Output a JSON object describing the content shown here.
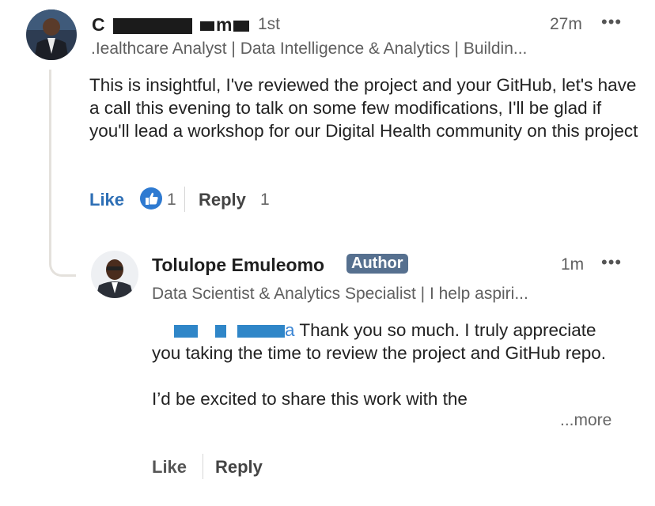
{
  "comment": {
    "author_name_visible": "C",
    "author_name_mid": "m",
    "degree": "1st",
    "time": "27m",
    "menu_icon": "more-dots-icon",
    "headline": ".Iealthcare Analyst | Data Intelligence & Analytics | Buildin...",
    "body": "This is insightful,  I've reviewed the project and your GitHub, let's have a call this evening to talk on some few modifications,  I'll be glad if you'll lead a workshop for our Digital Health community on this project",
    "like_label": "Like",
    "reaction_icon": "thumbs-up-icon",
    "reaction_count": "1",
    "reply_label": "Reply",
    "reply_count": "1"
  },
  "reply": {
    "author_name": "Tolulope Emuleomo",
    "badge": "Author",
    "time": "1m",
    "menu_icon": "more-dots-icon",
    "headline": "Data Scientist & Analytics Specialist | I help aspiri...",
    "mention_tail": "a",
    "body_line1": " Thank you so much. I truly appreciate you taking the time to review the project and GitHub repo.",
    "body_line2": "I’d be excited to share this work with the",
    "see_more": "...more",
    "like_label": "Like",
    "reply_label": "Reply"
  },
  "colors": {
    "link_blue": "#2e6fb5",
    "badge_bg": "#56708f",
    "thread_line": "#e4e1dc"
  }
}
